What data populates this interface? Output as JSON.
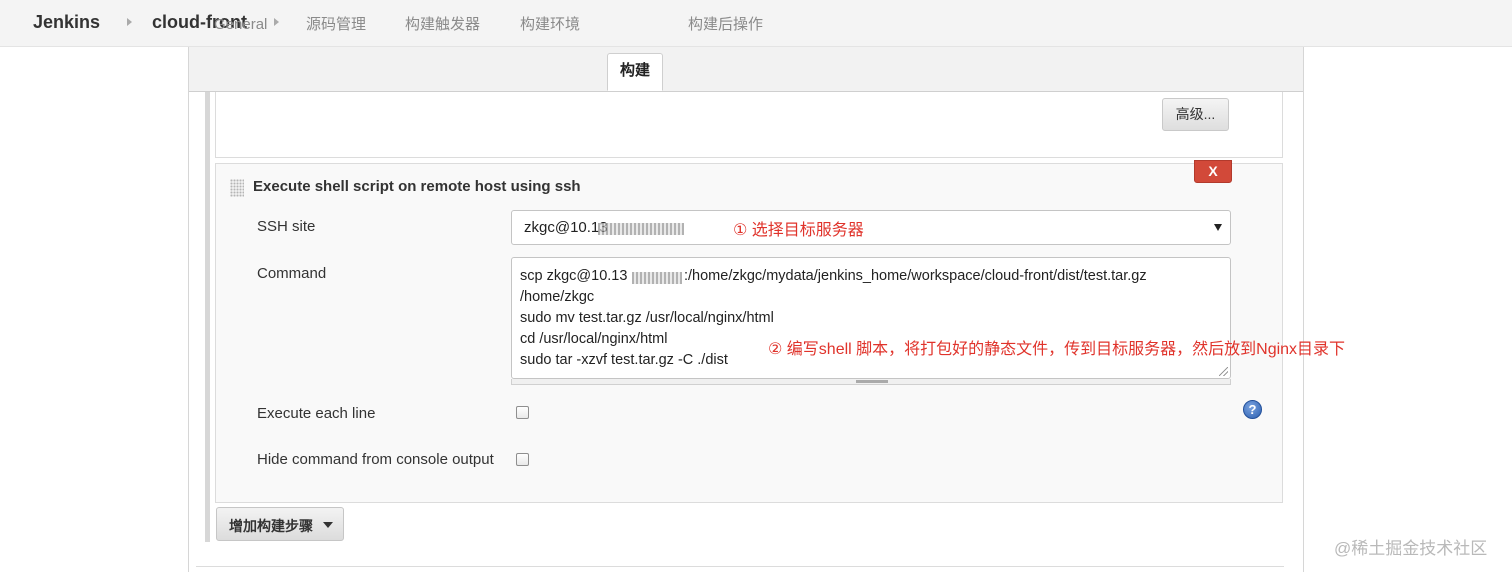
{
  "breadcrumb": {
    "root": "Jenkins",
    "project": "cloud-front"
  },
  "tabs": [
    {
      "label": "General"
    },
    {
      "label": "源码管理"
    },
    {
      "label": "构建触发器"
    },
    {
      "label": "构建环境"
    },
    {
      "label": "构建",
      "active": true
    },
    {
      "label": "构建后操作"
    }
  ],
  "previous_step": {
    "advanced_button": "高级..."
  },
  "ssh_step": {
    "title": "Execute shell script on remote host using ssh",
    "delete_button": "X",
    "ssh_site_label": "SSH site",
    "ssh_site_value": "zkgc@10.13",
    "command_label": "Command",
    "command_lines": [
      "scp zkgc@10.13",
      ":/home/zkgc/mydata/jenkins_home/workspace/cloud-front/dist/test.tar.gz",
      "/home/zkgc",
      "sudo mv test.tar.gz /usr/local/nginx/html",
      "cd /usr/local/nginx/html",
      "sudo tar -xzvf test.tar.gz  -C ./dist"
    ],
    "execute_each_line_label": "Execute each line",
    "execute_each_line_checked": false,
    "hide_command_label": "Hide command from console output",
    "hide_command_checked": false,
    "help_icon": "?"
  },
  "annotations": {
    "step1": "① 选择目标服务器",
    "step2": "② 编写shell 脚本，将打包好的静态文件，传到目标服务器，然后放到Nginx目录下"
  },
  "add_step_button": "增加构建步骤",
  "watermark": "@稀土掘金技术社区",
  "colors": {
    "delete_button": "#d24939",
    "annotation": "#e0332b",
    "help_icon": "#2b5fb0"
  }
}
